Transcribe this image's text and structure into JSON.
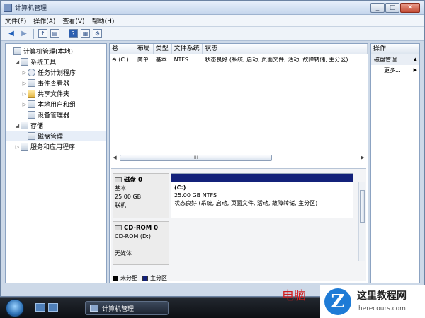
{
  "window": {
    "title": "计算机管理",
    "buttons": [
      "_",
      "□",
      "✕"
    ]
  },
  "menu": [
    "文件(F)",
    "操作(A)",
    "查看(V)",
    "帮助(H)"
  ],
  "toolbar": {
    "icons": [
      "back-arrow",
      "forward-arrow",
      "up-folder",
      "show-tree",
      "help",
      "properties",
      "disk-settings"
    ]
  },
  "tree": [
    {
      "label": "计算机管理(本地)",
      "indent": 0,
      "twisty": "",
      "icon": "computer"
    },
    {
      "label": "系统工具",
      "indent": 1,
      "twisty": "◢",
      "icon": "tools"
    },
    {
      "label": "任务计划程序",
      "indent": 2,
      "twisty": "▷",
      "icon": "clock"
    },
    {
      "label": "事件查看器",
      "indent": 2,
      "twisty": "▷",
      "icon": "event"
    },
    {
      "label": "共享文件夹",
      "indent": 2,
      "twisty": "▷",
      "icon": "folder"
    },
    {
      "label": "本地用户和组",
      "indent": 2,
      "twisty": "▷",
      "icon": "users"
    },
    {
      "label": "设备管理器",
      "indent": 2,
      "twisty": "",
      "icon": "device"
    },
    {
      "label": "存储",
      "indent": 1,
      "twisty": "◢",
      "icon": "storage"
    },
    {
      "label": "磁盘管理",
      "indent": 2,
      "twisty": "",
      "icon": "disk",
      "selected": true
    },
    {
      "label": "服务和应用程序",
      "indent": 1,
      "twisty": "▷",
      "icon": "services"
    }
  ],
  "volumes": {
    "columns": [
      "卷",
      "布局",
      "类型",
      "文件系统",
      "状态"
    ],
    "rows": [
      [
        "(C:)",
        "简单",
        "基本",
        "NTFS",
        "状态良好 (系统, 启动, 页面文件, 活动, 故障转储, 主分区)"
      ]
    ]
  },
  "hscroll_thumb_label": "III",
  "disks": [
    {
      "name": "磁盘 0",
      "type": "基本",
      "size": "25.00 GB",
      "status": "联机",
      "partition": {
        "label": "(C:)",
        "size": "25.00 GB NTFS",
        "status": "状态良好 (系统, 启动, 页面文件, 活动, 故障转储, 主分区)"
      }
    },
    {
      "name": "CD-ROM 0",
      "type": "CD-ROM (D:)",
      "size": "",
      "status": "无媒体"
    }
  ],
  "legend": [
    {
      "label": "未分配",
      "color": "#000000"
    },
    {
      "label": "主分区",
      "color": "#13217a"
    }
  ],
  "actions": {
    "header": "操作",
    "section": "磁盘管理",
    "items": [
      "更多..."
    ]
  },
  "taskbar": {
    "task_label": "计算机管理"
  },
  "watermark": {
    "red_text": "电脑",
    "site_name": "这里教程网",
    "url": "herecours.com",
    "logo_letter": "Z"
  }
}
